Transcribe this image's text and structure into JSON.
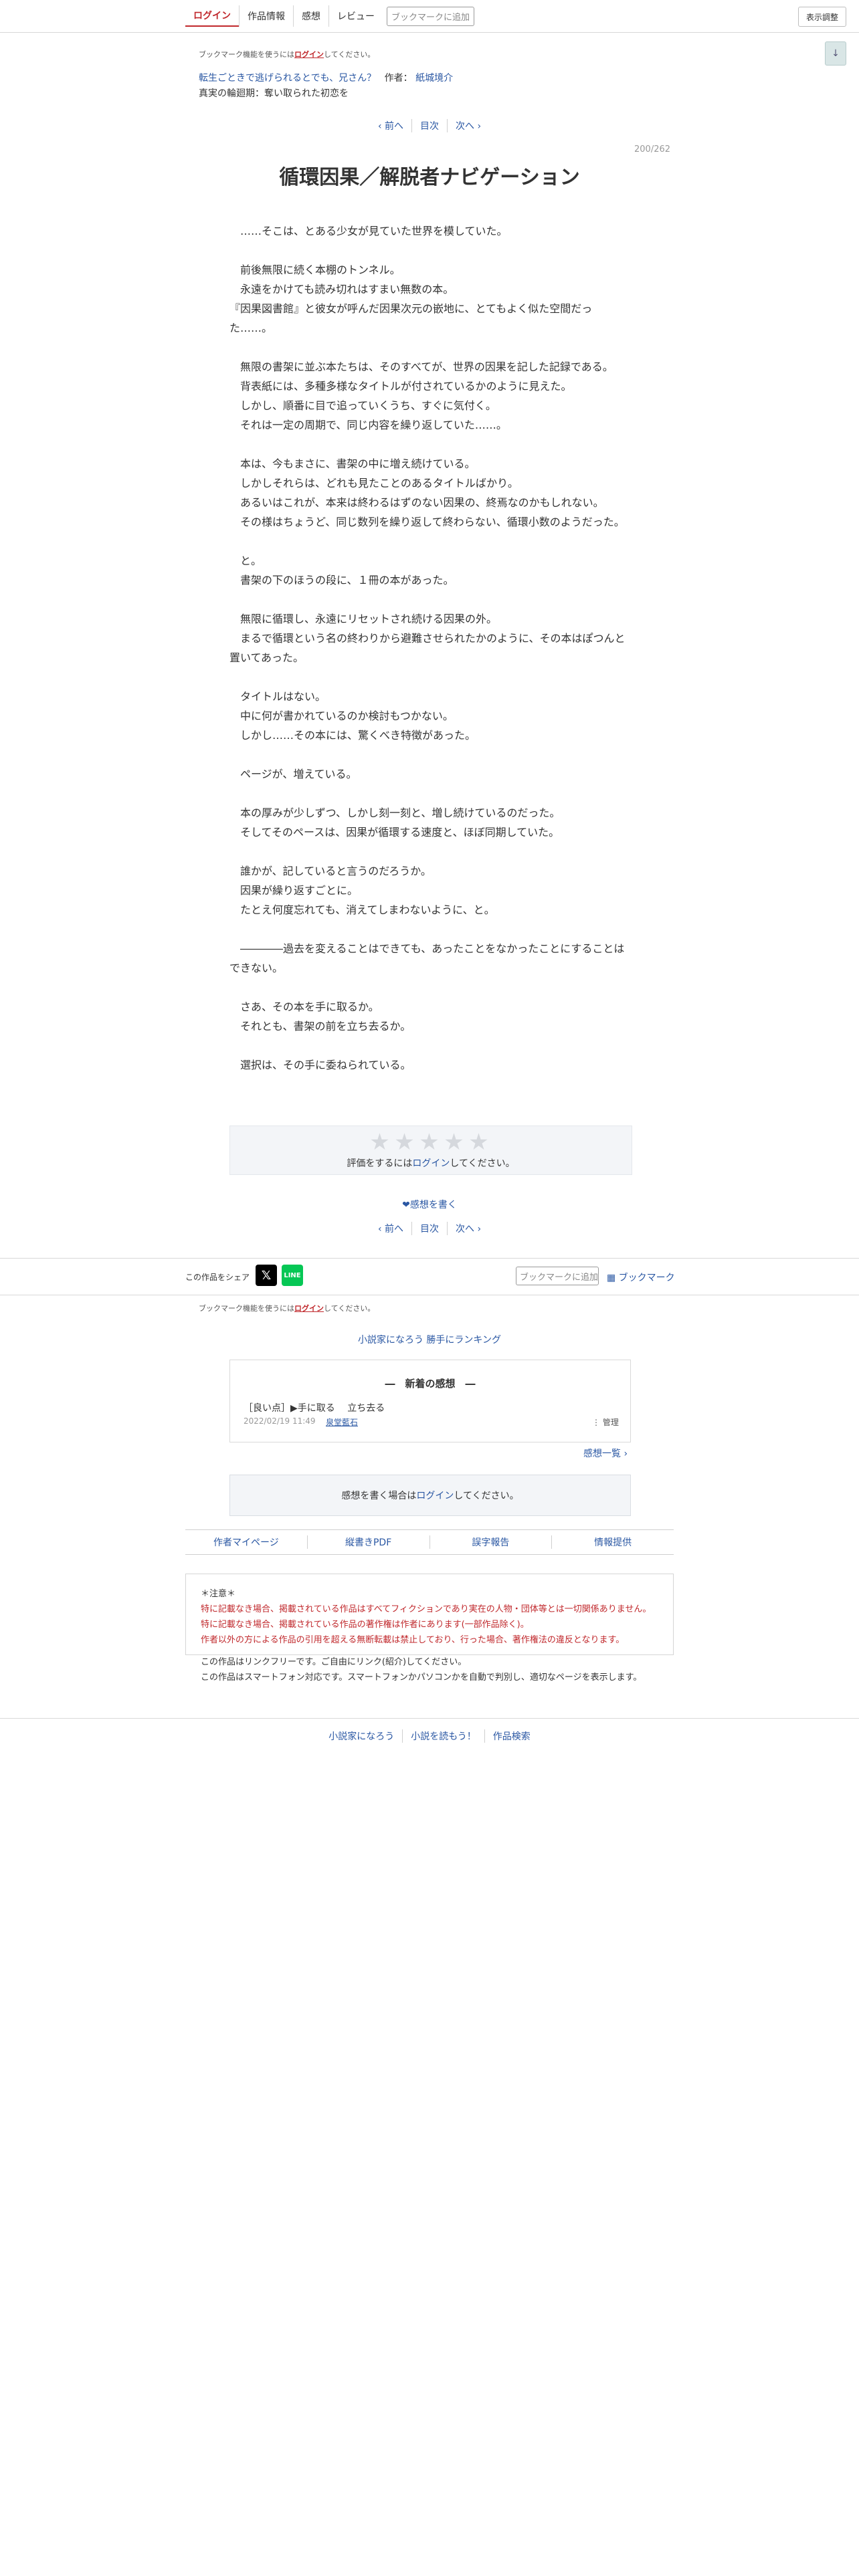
{
  "header": {
    "nav": [
      "ログイン",
      "作品情報",
      "感想",
      "レビュー"
    ],
    "bookmark_placeholder": "ブックマークに追加",
    "display_button": "表示調整",
    "down_button": "↓"
  },
  "notice_top": {
    "prefix": "ブックマーク機能を使うには",
    "login": "ログイン",
    "suffix": "してください。"
  },
  "series": {
    "title": "転生ごときで逃げられるとでも、兄さん？",
    "author_label": "作者：",
    "author": "紙城境介"
  },
  "subtitle": "真実の輪廻期：奪い取られた初恋を",
  "pager": {
    "prev": "‹ 前へ",
    "toc": "目次",
    "next": "次へ ›"
  },
  "page_counter": "200/262",
  "chapter_title": "循環因果／解脱者ナビゲーション",
  "body": [
    "　……そこは、とある少女が見ていた世界を模していた。",
    "",
    "　前後無限に続く本棚のトンネル。",
    "　永遠をかけても読み切れはすまい無数の本。",
    "『因果図書館』と彼女が呼んだ因果次元の嵌地に、とてもよく似た空間だった……。",
    "",
    "　無限の書架に並ぶ本たちは、そのすべてが、世界の因果を記した記録である。",
    "　背表紙には、多種多様なタイトルが付されているかのように見えた。",
    "　しかし、順番に目で追っていくうち、すぐに気付く。",
    "　それは一定の周期で、同じ内容を繰り返していた……。",
    "",
    "　本は、今もまさに、書架の中に増え続けている。",
    "　しかしそれらは、どれも見たことのあるタイトルばかり。",
    "　あるいはこれが、本来は終わるはずのない因果の、終焉なのかもしれない。",
    "　その様はちょうど、同じ数列を繰り返して終わらない、循環小数のようだった。",
    "",
    "　と。",
    "　書架の下のほうの段に、１冊の本があった。",
    "",
    "　無限に循環し、永遠にリセットされ続ける因果の外。",
    "　まるで循環という名の終わりから避難させられたかのように、その本はぽつんと置いてあった。",
    "",
    "　タイトルはない。",
    "　中に何が書かれているのか検討もつかない。",
    "　しかし……その本には、驚くべき特徴があった。",
    "",
    "　ページが、増えている。",
    "",
    "　本の厚みが少しずつ、しかし刻一刻と、増し続けているのだった。",
    "　そしてそのペースは、因果が循環する速度と、ほぼ同期していた。",
    "",
    "　誰かが、記していると言うのだろうか。",
    "　因果が繰り返すごとに。",
    "　たとえ何度忘れても、消えてしまわないように、と。",
    "",
    "　――――過去を変えることはできても、あったことをなかったことにすることはできない。",
    "",
    "　さあ、その本を手に取るか。",
    "　それとも、書架の前を立ち去るか。",
    "",
    "　選択は、その手に委ねられている。"
  ],
  "rating": {
    "stars": [
      "★",
      "★",
      "★",
      "★",
      "★"
    ],
    "prefix": "評価をするには",
    "login": "ログイン",
    "suffix": "してください。"
  },
  "write_impression": "❤感想を書く",
  "share": {
    "label": "この作品をシェア",
    "x": "𝕏",
    "line": "LINE",
    "bookmark_placeholder": "ブックマークに追加",
    "bookmark_link": "▦ ブックマーク"
  },
  "notice_bottom": {
    "prefix": "ブックマーク機能を使うには",
    "login": "ログイン",
    "suffix": "してください。"
  },
  "ranking": "小説家になろう 勝手にランキング",
  "impressions": {
    "heading": "―　新着の感想　―",
    "item_text": "［良い点］▶手に取る　 立ち去る",
    "item_date": "2022/02/19 11:49",
    "item_author": "泉堂藍石",
    "manage": "⋮ 管理",
    "list_link": "感想一覧 ›"
  },
  "write_box": {
    "prefix": "感想を書く場合は",
    "login": "ログイン",
    "suffix": "してください。"
  },
  "footer_links": [
    "作者マイページ",
    "縦書きPDF",
    "誤字報告",
    "情報提供"
  ],
  "notice": {
    "title": "＊注意＊",
    "red_lines": [
      "特に記載なき場合、掲載されている作品はすべてフィクションであり実在の人物・団体等とは一切関係ありません。",
      "特に記載なき場合、掲載されている作品の著作権は作者にあります(一部作品除く)。",
      "作者以外の方による作品の引用を超える無断転載は禁止しており、行った場合、著作権法の違反となります。"
    ],
    "lines": [
      "この作品はリンクフリーです。ご自由にリンク(紹介)してください。",
      "この作品はスマートフォン対応です。スマートフォンかパソコンかを自動で判別し、適切なページを表示します。"
    ]
  },
  "bottom_links": [
    "小説家になろう",
    "小説を読もう！",
    "作品検索"
  ]
}
